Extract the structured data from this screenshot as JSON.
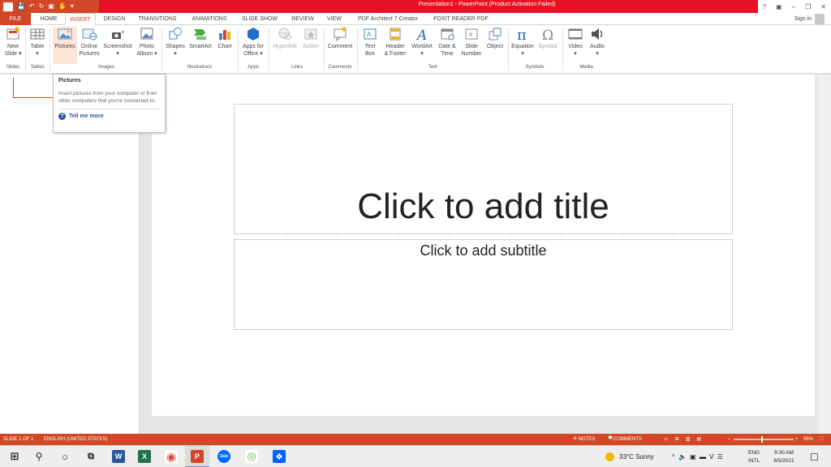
{
  "window": {
    "title": "Presentation1 - PowerPoint (Product Activation Failed)",
    "help": "?",
    "ribbon_opts": "▣",
    "minimize": "–",
    "maximize": "❐",
    "close": "✕"
  },
  "qat": {
    "logo": "P",
    "save": "💾",
    "undo": "↶",
    "redo": "↻",
    "start": "▣",
    "touch": "✋",
    "more": "▾"
  },
  "tabs": [
    "FILE",
    "HOME",
    "INSERT",
    "DESIGN",
    "TRANSITIONS",
    "ANIMATIONS",
    "SLIDE SHOW",
    "REVIEW",
    "VIEW",
    "PDF Architect 7 Creator",
    "FOXIT READER PDF"
  ],
  "sign_in": "Sign in",
  "ribbon": {
    "new_slide": [
      "New",
      "Slide ▾"
    ],
    "table": [
      "Table",
      "▾"
    ],
    "pictures": "Pictures",
    "online_pictures": [
      "Online",
      "Pictures"
    ],
    "screenshot": [
      "Screenshot",
      "▾"
    ],
    "photo_album": [
      "Photo",
      "Album ▾"
    ],
    "shapes": [
      "Shapes",
      "▾"
    ],
    "smartart": "SmartArt",
    "chart": "Chart",
    "apps_for_office": [
      "Apps for",
      "Office ▾"
    ],
    "hyperlink": "Hyperlink",
    "action": "Action",
    "comment": "Comment",
    "text_box": [
      "Text",
      "Box"
    ],
    "header_footer": [
      "Header",
      "& Footer"
    ],
    "wordart": [
      "WordArt",
      "▾"
    ],
    "date_time": [
      "Date &",
      "Time"
    ],
    "slide_number": [
      "Slide",
      "Number"
    ],
    "object": "Object",
    "equation": [
      "Equation",
      "▾"
    ],
    "symbol": "Symbol",
    "video": [
      "Video",
      "▾"
    ],
    "audio": [
      "Audio",
      "▾"
    ],
    "groups": [
      "Slides",
      "Tables",
      "Images",
      "Illustrations",
      "Apps",
      "Links",
      "Comments",
      "Text",
      "Symbols",
      "Media"
    ]
  },
  "tooltip": {
    "title": "Pictures",
    "body": "Insert pictures from your computer or from other computers that you're connected to.",
    "link": "Tell me more"
  },
  "slide": {
    "title_placeholder": "Click to add title",
    "subtitle_placeholder": "Click to add subtitle"
  },
  "status": {
    "slide": "SLIDE 1 OF 1",
    "language": "ENGLISH (UNITED STATES)",
    "notes": "≙ NOTES",
    "comments": "▀ COMMENTS",
    "zoom": "96%",
    "zoom_minus": "−",
    "zoom_plus": "+",
    "fit": "⛶"
  },
  "taskbar": {
    "start": "⊞",
    "search": "⚲",
    "cortana": "○",
    "taskview": "⧉",
    "word": "W",
    "excel": "X",
    "chrome": "◉",
    "powerpoint": "P",
    "zalo": "Zalo",
    "app": "◎",
    "dropbox": "❖",
    "weather": "33°C  Sunny",
    "tray": "^  🔈  ▣  ▬  V  ☰",
    "lang_top": "ENG",
    "lang_bottom": "INTL",
    "time": "9:30 AM",
    "date": "8/5/2021",
    "notify": "☐"
  },
  "colors": {
    "accent": "#d24726",
    "failed_bar": "#e81123",
    "link": "#2b579a"
  }
}
